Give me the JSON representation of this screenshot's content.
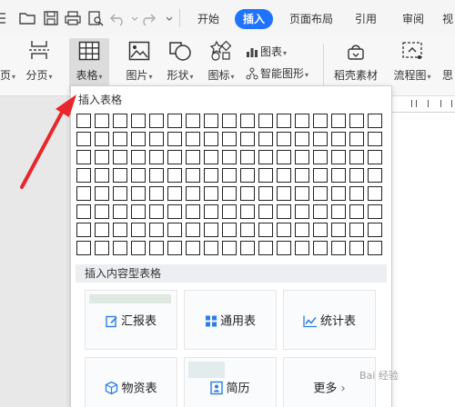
{
  "tabs": {
    "start": "开始",
    "insert": "插入",
    "page_layout": "页面布局",
    "references": "引用",
    "review": "审阅",
    "view_partial": "视"
  },
  "ribbon": {
    "partial_left": "页",
    "page_break": "分页",
    "table": "表格",
    "picture": "图片",
    "shape": "形状",
    "icon": "图标",
    "chart": "图表",
    "smart_graphic": "智能图形",
    "docer_material": "稻壳素材",
    "flowchart": "流程图",
    "mind_partial": "思"
  },
  "dropdown": {
    "insert_table_title": "插入表格",
    "content_table_title": "插入内容型表格",
    "cards": [
      "汇报表",
      "通用表",
      "统计表",
      "物资表",
      "简历",
      "更多"
    ]
  },
  "watermark": "Bai 经验"
}
